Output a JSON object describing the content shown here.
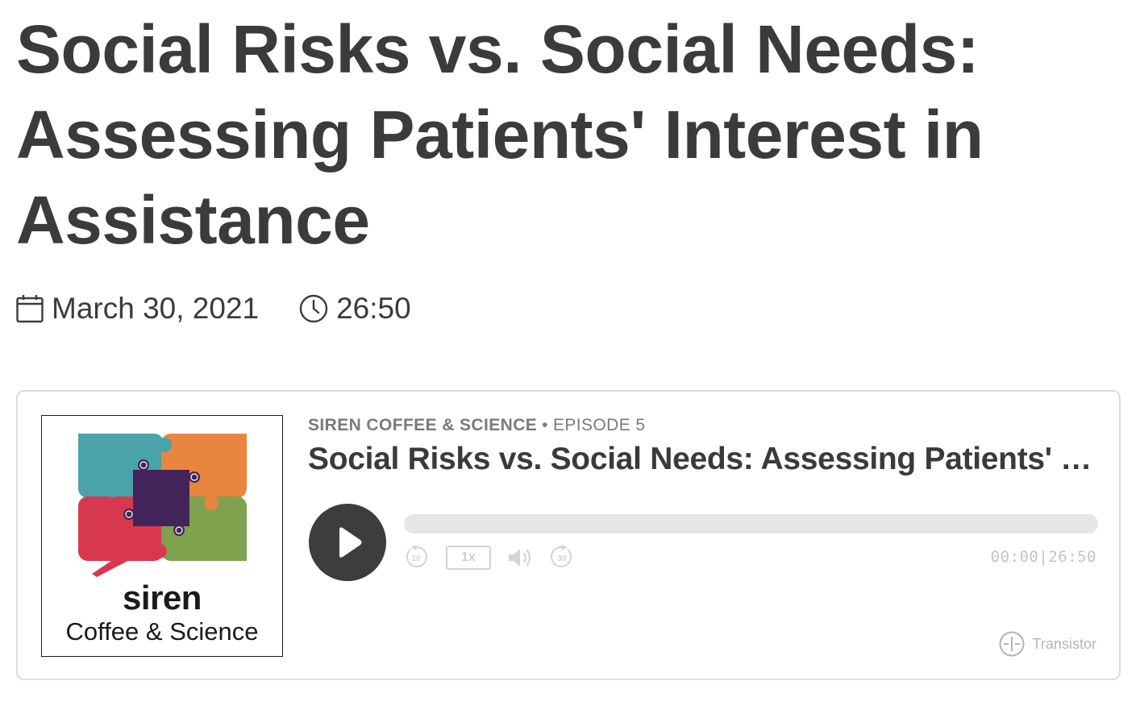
{
  "page": {
    "title": "Social Risks vs. Social Needs: Assessing Patients' Interest in Assistance",
    "date": "March 30, 2021",
    "duration": "26:50",
    "date_icon": "calendar-icon",
    "duration_icon": "clock-icon"
  },
  "player": {
    "show_name": "SIREN COFFEE & SCIENCE",
    "separator": "•",
    "episode_label": "EPISODE 5",
    "episode_title": "Social Risks vs. Social Needs: Assessing Patients' Interest in Assistance",
    "cover": {
      "brand_name": "siren",
      "brand_subtitle": "Coffee & Science",
      "puzzle_colors": [
        "#4aa3a8",
        "#e8863f",
        "#d8384f",
        "#7ea24e",
        "#43245a"
      ]
    },
    "speed_label": "1x",
    "current_time": "00:00",
    "time_separator": "|",
    "total_time": "26:50",
    "progress": 0,
    "rewind_seconds": "10",
    "forward_seconds": "30",
    "branding": "Transistor",
    "icons": [
      "play-icon",
      "rewind-10-icon",
      "volume-icon",
      "forward-30-icon",
      "transistor-logo-icon"
    ]
  }
}
